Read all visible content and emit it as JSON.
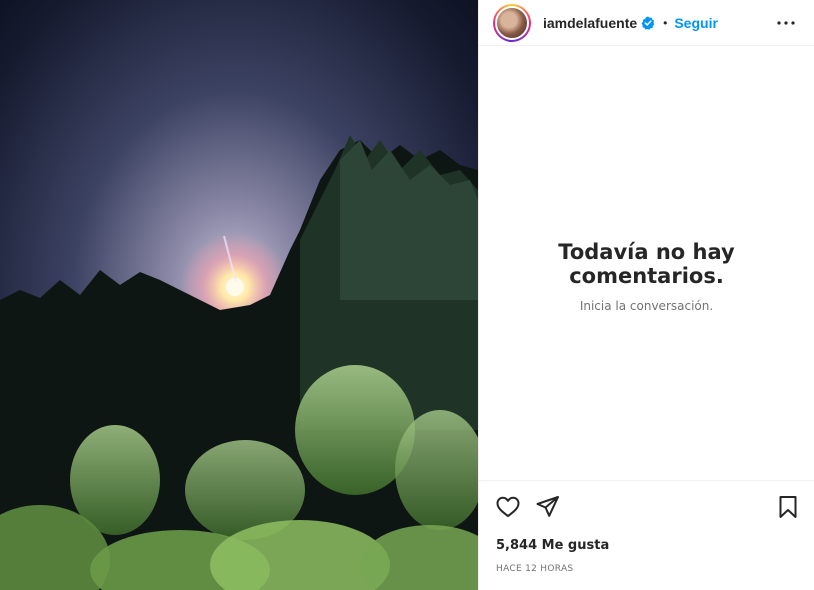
{
  "post": {
    "image_alt": "Foto nocturna de árboles iluminados bajo la luna",
    "author": {
      "username": "iamdelafuente",
      "verified": true
    },
    "follow_label": "Seguir",
    "separator": "•",
    "comments_empty": {
      "title": "Todavía no hay comentarios.",
      "subtitle": "Inicia la conversación."
    },
    "likes_text": "5,844 Me gusta",
    "time_text": "HACE 12 HORAS",
    "icons": {
      "like": "heart-icon",
      "share": "paper-plane-icon",
      "save": "bookmark-icon",
      "more": "more-options-icon",
      "verified": "verified-badge-icon"
    },
    "colors": {
      "accent": "#0095f6",
      "verified": "#0095f6",
      "text": "#262626",
      "muted": "#737373"
    }
  }
}
